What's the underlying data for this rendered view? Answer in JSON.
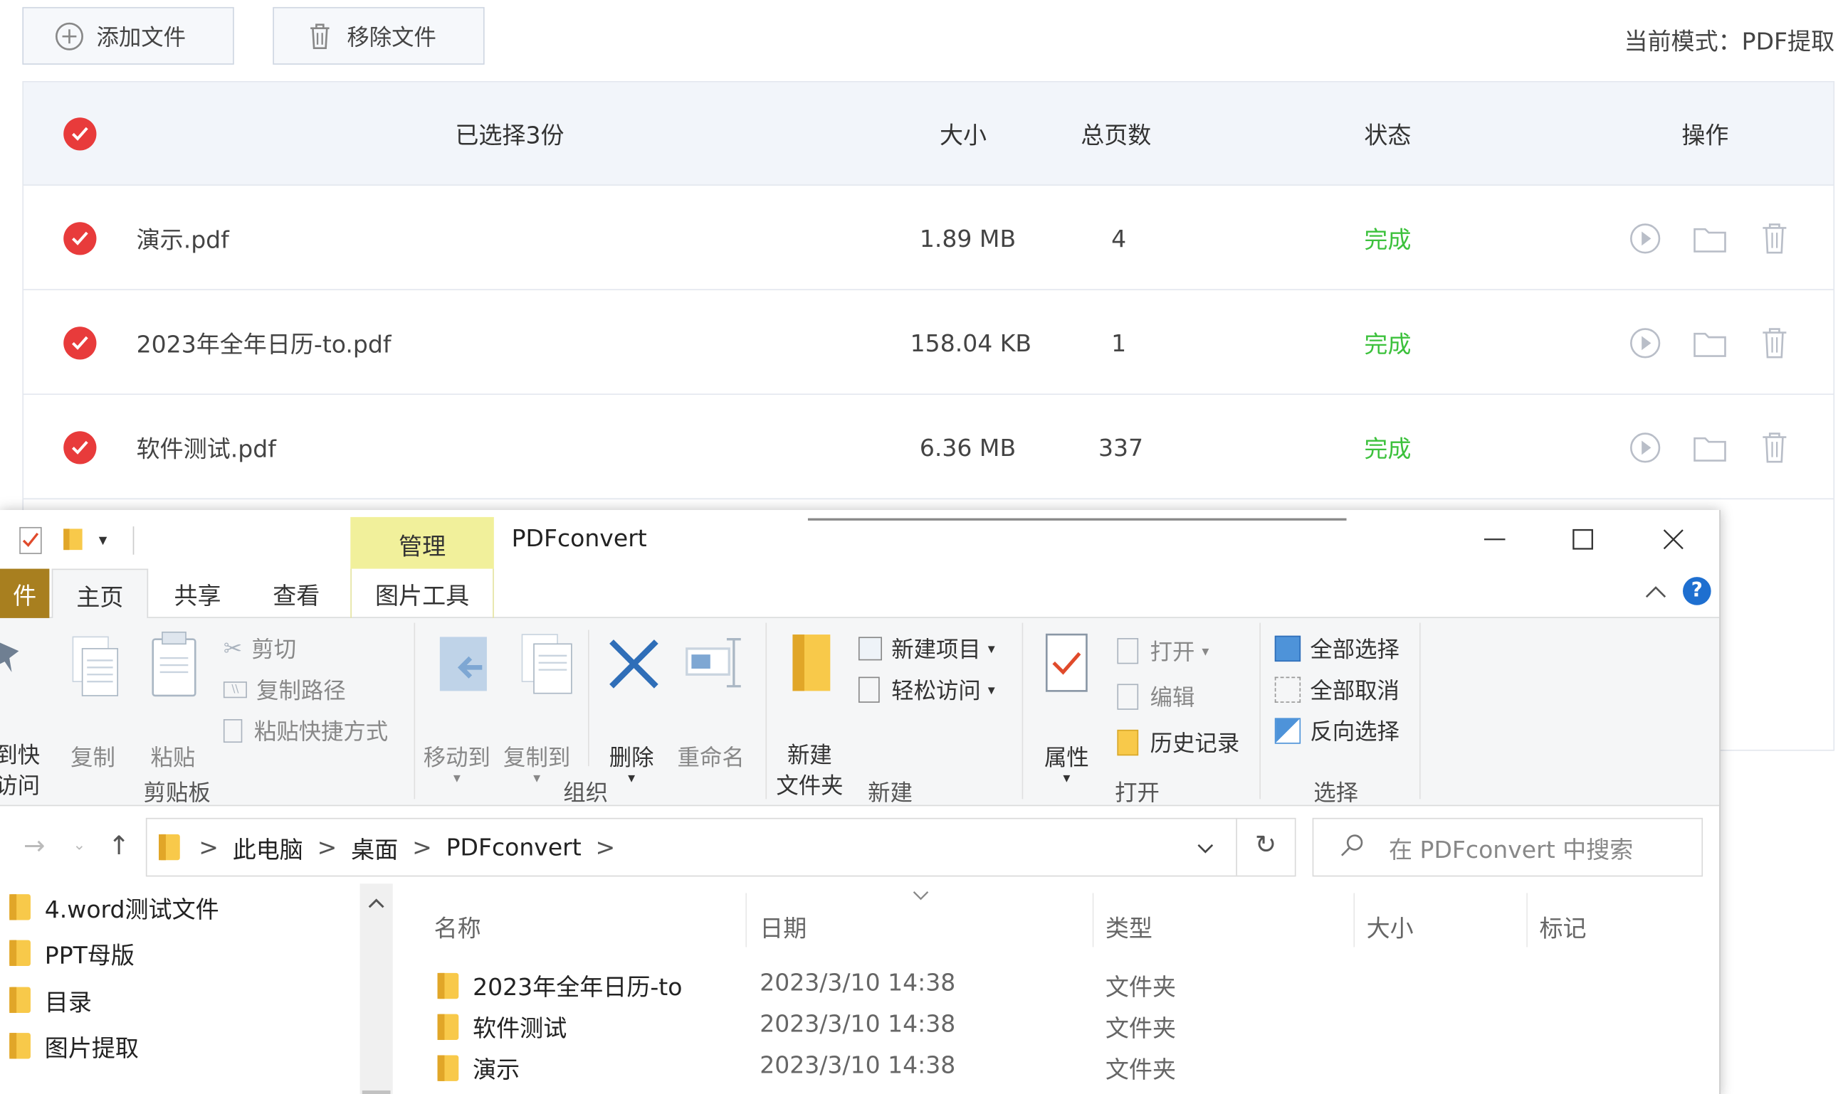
{
  "app": {
    "toolbar": {
      "add_label": "添加文件",
      "remove_label": "移除文件"
    },
    "mode_text": "当前模式：PDF提取",
    "table": {
      "headers": {
        "selected": "已选择3份",
        "size": "大小",
        "pages": "总页数",
        "status": "状态",
        "actions": "操作"
      },
      "rows": [
        {
          "name": "演示.pdf",
          "size": "1.89 MB",
          "pages": "4",
          "status": "完成"
        },
        {
          "name": "2023年全年日历-to.pdf",
          "size": "158.04 KB",
          "pages": "1",
          "status": "完成"
        },
        {
          "name": "软件测试.pdf",
          "size": "6.36 MB",
          "pages": "337",
          "status": "完成"
        }
      ]
    },
    "colors": {
      "check_red": "#e83b3b",
      "done_green": "#3cc13c"
    }
  },
  "explorer": {
    "context_tab": "管理",
    "window_title": "PDFconvert",
    "tabs": {
      "file": "件",
      "home": "主页",
      "share": "共享",
      "view": "查看",
      "picture_tools": "图片工具"
    },
    "ribbon": {
      "clipboard": {
        "pin": "到快",
        "pin2": "访问",
        "copy": "复制",
        "paste": "粘贴",
        "cut": "剪切",
        "copy_path": "复制路径",
        "paste_shortcut": "粘贴快捷方式",
        "group": "剪贴板"
      },
      "organize": {
        "move_to": "移动到",
        "copy_to": "复制到",
        "delete": "删除",
        "rename": "重命名",
        "group": "组织"
      },
      "new": {
        "new_item": "新建项目",
        "easy_access": "轻松访问",
        "new_folder_1": "新建",
        "new_folder_2": "文件夹",
        "group": "新建"
      },
      "open": {
        "properties": "属性",
        "open": "打开",
        "edit": "编辑",
        "history": "历史记录",
        "group": "打开"
      },
      "select": {
        "select_all": "全部选择",
        "select_none": "全部取消",
        "invert": "反向选择",
        "group": "选择"
      }
    },
    "address": {
      "crumbs": [
        "此电脑",
        "桌面",
        "PDFconvert"
      ],
      "sep": ">"
    },
    "search_placeholder": "在 PDFconvert 中搜索",
    "nav_items": [
      "4.word测试文件",
      "PPT母版",
      "目录",
      "图片提取"
    ],
    "columns": {
      "name": "名称",
      "date": "日期",
      "type": "类型",
      "size": "大小",
      "tag": "标记"
    },
    "files": [
      {
        "name": "2023年全年日历-to",
        "date": "2023/3/10 14:38",
        "type": "文件夹"
      },
      {
        "name": "软件测试",
        "date": "2023/3/10 14:38",
        "type": "文件夹"
      },
      {
        "name": "演示",
        "date": "2023/3/10 14:38",
        "type": "文件夹"
      }
    ]
  }
}
